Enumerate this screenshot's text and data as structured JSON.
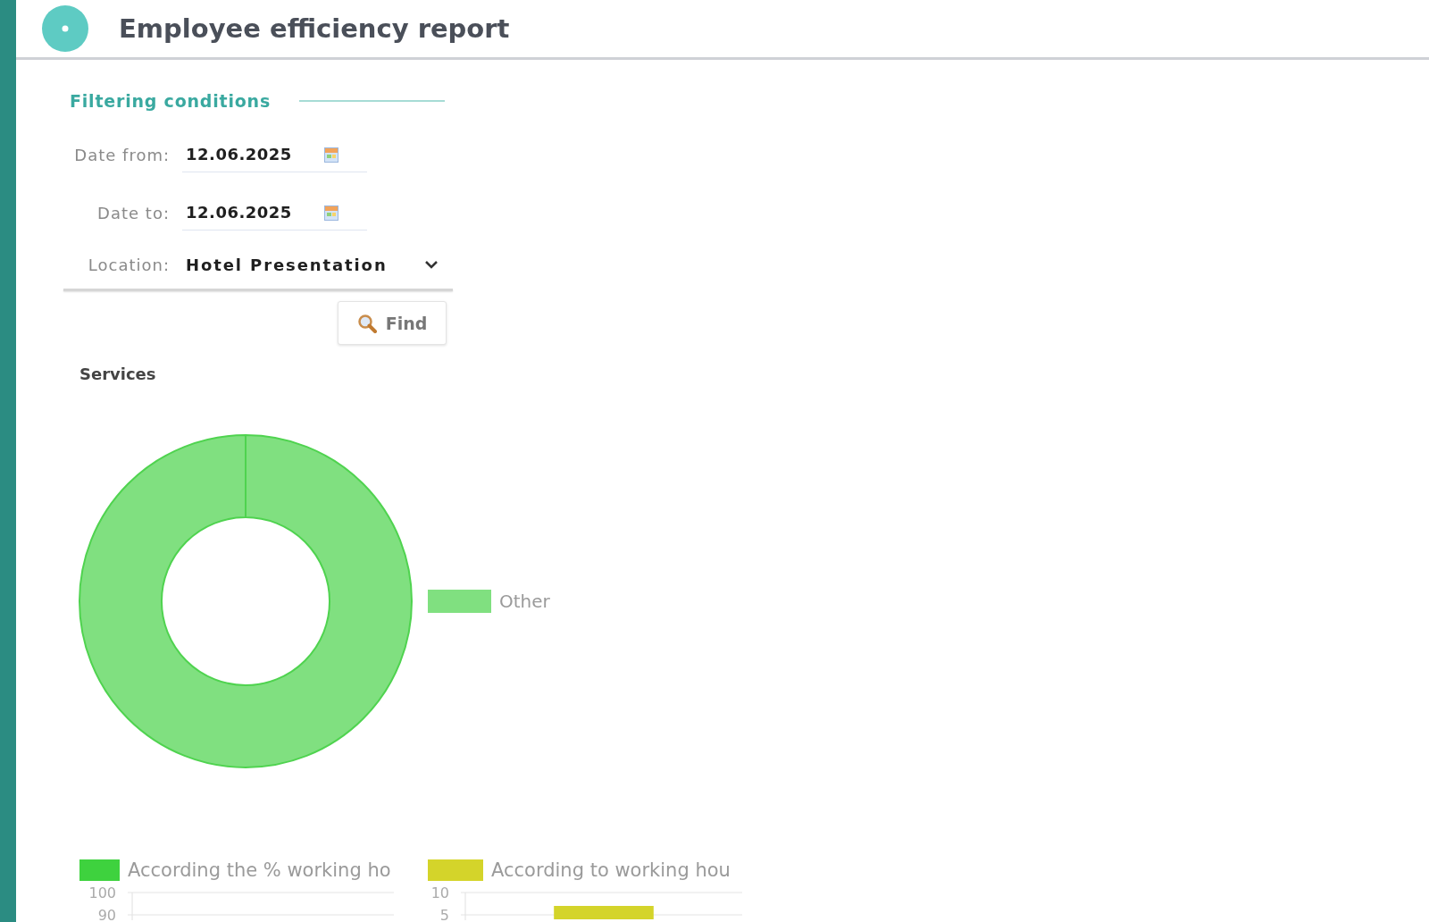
{
  "header": {
    "title": "Employee efficiency report"
  },
  "filters": {
    "title": "Filtering conditions",
    "fields": [
      {
        "kind": "date",
        "label": "Date from:",
        "value": "12.06.2025"
      },
      {
        "kind": "date",
        "label": "Date to:",
        "value": "12.06.2025"
      },
      {
        "kind": "select",
        "label": "Location:",
        "value": "Hotel Presentation"
      }
    ],
    "button": "Find"
  },
  "services": {
    "chart_data": [
      {
        "type": "donut",
        "title": "Services",
        "categories": [
          "Other"
        ],
        "values": [
          100
        ],
        "colors": [
          "#80e080"
        ],
        "legend": "right"
      }
    ]
  },
  "efficiency": {
    "chart_data": [
      {
        "type": "bar",
        "series": [
          {
            "name": "According the % working ho",
            "color": "#3ed23e"
          }
        ],
        "yticks": [
          100,
          90
        ],
        "ylim": [
          88,
          100
        ],
        "grid": true,
        "legend": "top"
      },
      {
        "type": "bar",
        "categories": [
          null
        ],
        "series": [
          {
            "name": "According to working hou",
            "color": "#d4d42a",
            "values": [
              7
            ]
          }
        ],
        "yticks": [
          10,
          5
        ],
        "ylim": [
          4,
          10
        ],
        "grid": true,
        "legend": "top"
      }
    ]
  }
}
